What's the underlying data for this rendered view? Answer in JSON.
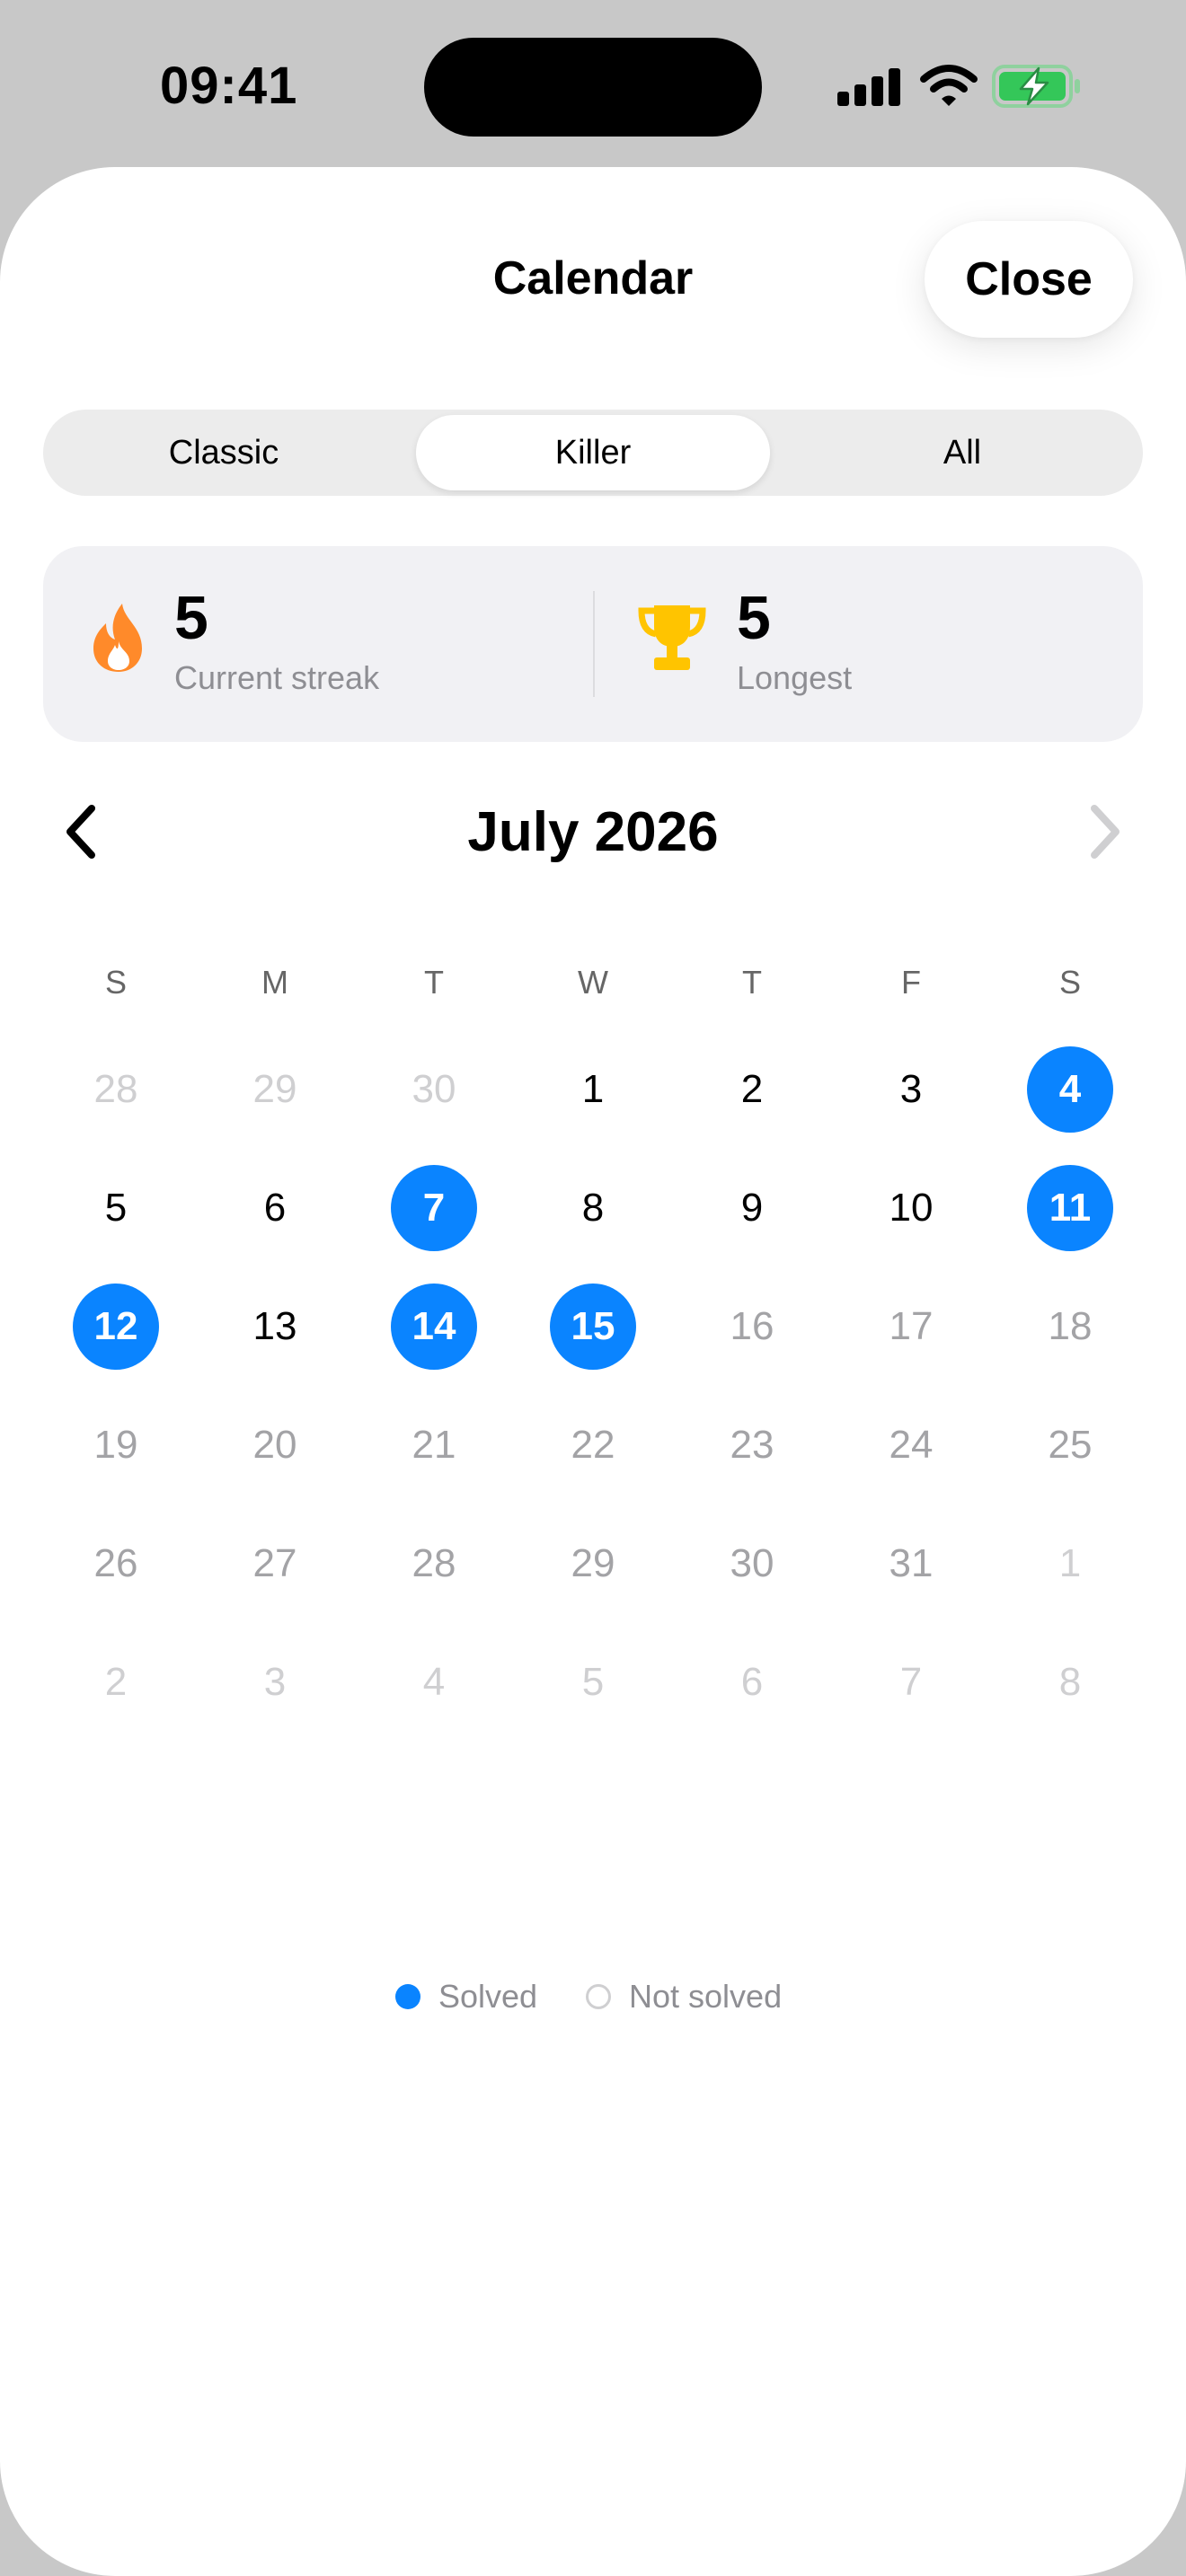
{
  "status_bar": {
    "time": "09:41",
    "icons": [
      "cellular-signal-icon",
      "wifi-icon",
      "battery-charging-icon"
    ],
    "battery_color": "#34c759"
  },
  "sheet": {
    "title": "Calendar",
    "close_label": "Close"
  },
  "mode_tabs": [
    {
      "label": "Classic",
      "selected": false
    },
    {
      "label": "Killer",
      "selected": true
    },
    {
      "label": "All",
      "selected": false
    }
  ],
  "streaks": {
    "current": {
      "value": "5",
      "label": "Current streak",
      "icon": "flame-icon",
      "color": "#ff8a2a"
    },
    "longest": {
      "value": "5",
      "label": "Longest",
      "icon": "trophy-icon",
      "color": "#ffc400"
    }
  },
  "calendar": {
    "month_label": "July 2026",
    "prev_icon": "chevron-left-icon",
    "next_icon": "chevron-right-icon",
    "weekdays": [
      "S",
      "M",
      "T",
      "W",
      "T",
      "F",
      "S"
    ],
    "accent_color": "#0a84ff",
    "weeks": [
      [
        {
          "d": "28",
          "s": "adj"
        },
        {
          "d": "29",
          "s": "adj"
        },
        {
          "d": "30",
          "s": "adj"
        },
        {
          "d": "1",
          "s": "past"
        },
        {
          "d": "2",
          "s": "past"
        },
        {
          "d": "3",
          "s": "past"
        },
        {
          "d": "4",
          "s": "solved"
        }
      ],
      [
        {
          "d": "5",
          "s": "past"
        },
        {
          "d": "6",
          "s": "past"
        },
        {
          "d": "7",
          "s": "solved"
        },
        {
          "d": "8",
          "s": "past"
        },
        {
          "d": "9",
          "s": "past"
        },
        {
          "d": "10",
          "s": "past"
        },
        {
          "d": "11",
          "s": "solved"
        }
      ],
      [
        {
          "d": "12",
          "s": "solved"
        },
        {
          "d": "13",
          "s": "past"
        },
        {
          "d": "14",
          "s": "solved"
        },
        {
          "d": "15",
          "s": "solved"
        },
        {
          "d": "16",
          "s": "future"
        },
        {
          "d": "17",
          "s": "future"
        },
        {
          "d": "18",
          "s": "future"
        }
      ],
      [
        {
          "d": "19",
          "s": "future"
        },
        {
          "d": "20",
          "s": "future"
        },
        {
          "d": "21",
          "s": "future"
        },
        {
          "d": "22",
          "s": "future"
        },
        {
          "d": "23",
          "s": "future"
        },
        {
          "d": "24",
          "s": "future"
        },
        {
          "d": "25",
          "s": "future"
        }
      ],
      [
        {
          "d": "26",
          "s": "future"
        },
        {
          "d": "27",
          "s": "future"
        },
        {
          "d": "28",
          "s": "future"
        },
        {
          "d": "29",
          "s": "future"
        },
        {
          "d": "30",
          "s": "future"
        },
        {
          "d": "31",
          "s": "future"
        },
        {
          "d": "1",
          "s": "adj"
        }
      ],
      [
        {
          "d": "2",
          "s": "adj"
        },
        {
          "d": "3",
          "s": "adj"
        },
        {
          "d": "4",
          "s": "adj"
        },
        {
          "d": "5",
          "s": "adj"
        },
        {
          "d": "6",
          "s": "adj"
        },
        {
          "d": "7",
          "s": "adj"
        },
        {
          "d": "8",
          "s": "adj"
        }
      ]
    ]
  },
  "legend": {
    "solved": "Solved",
    "not_solved": "Not solved"
  }
}
